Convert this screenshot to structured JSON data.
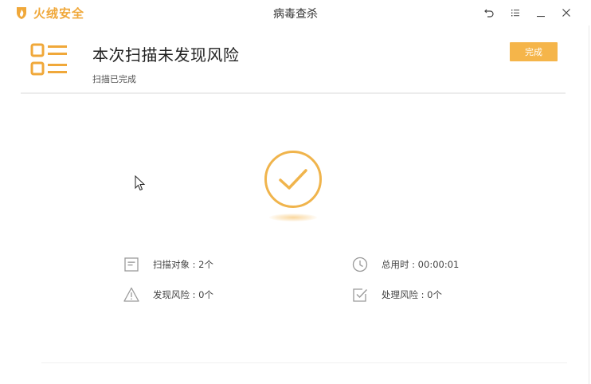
{
  "titlebar": {
    "brand_name": "火绒安全",
    "window_title": "病毒查杀",
    "controls": [
      "back-icon",
      "menu-icon",
      "minimize-icon",
      "close-icon"
    ]
  },
  "result": {
    "title": "本次扫描未发现风险",
    "subtitle": "扫描已完成",
    "done_label": "完成"
  },
  "stats": {
    "scan_targets": "扫描对象 : 2个",
    "time_used": "总用时 : 00:00:01",
    "risks_found": "发现风险 : 0个",
    "risks_handled": "处理风险 : 0个"
  },
  "colors": {
    "accent": "#f5b54a",
    "brand": "#f0a83a",
    "icon_gray": "#9a9a9a"
  }
}
